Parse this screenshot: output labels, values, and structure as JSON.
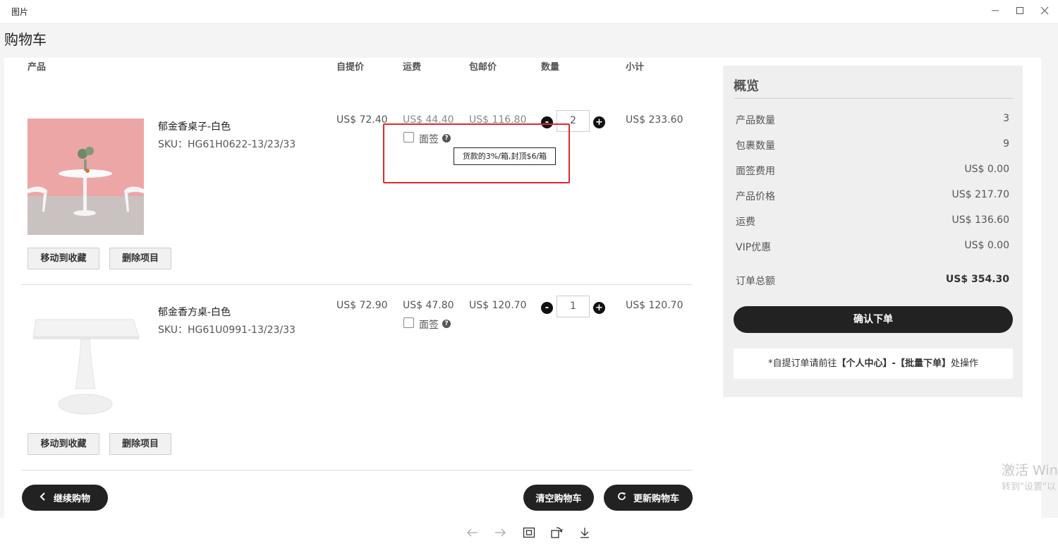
{
  "window": {
    "app_title": "图片"
  },
  "page": {
    "title": "购物车"
  },
  "table_headers": {
    "product": "产品",
    "pickup_price": "自提价",
    "shipping": "运费",
    "free_ship_price": "包邮价",
    "quantity": "数量",
    "subtotal": "小计"
  },
  "items": [
    {
      "name": "郁金香桌子-白色",
      "sku": "SKU：HG61H0622-13/23/33",
      "pickup_price": "US$ 72.40",
      "shipping": "US$ 44.40",
      "free_ship_price": "US$ 116.80",
      "quantity": "2",
      "subtotal": "US$ 233.60",
      "signature_label": "面签",
      "move_to_fav": "移动到收藏",
      "delete": "删除项目"
    },
    {
      "name": "郁金香方桌-白色",
      "sku": "SKU：HG61U0991-13/23/33",
      "pickup_price": "US$ 72.90",
      "shipping": "US$ 47.80",
      "free_ship_price": "US$ 120.70",
      "quantity": "1",
      "subtotal": "US$ 120.70",
      "signature_label": "面签",
      "move_to_fav": "移动到收藏",
      "delete": "删除项目"
    }
  ],
  "tooltip": "货款的3%/箱,封顶$6/箱",
  "qty_controls": {
    "minus": "-",
    "plus": "+"
  },
  "actions": {
    "continue_shopping": "继续购物",
    "clear_cart": "清空购物车",
    "update_cart": "更新购物车"
  },
  "summary": {
    "title": "概览",
    "rows": [
      {
        "label": "产品数量",
        "value": "3"
      },
      {
        "label": "包裹数量",
        "value": "9"
      },
      {
        "label": "面签费用",
        "value": "US$ 0.00"
      },
      {
        "label": "产品价格",
        "value": "US$ 217.70"
      },
      {
        "label": "运费",
        "value": "US$ 136.60"
      },
      {
        "label": "VIP优惠",
        "value": "US$ 0.00"
      }
    ],
    "total_label": "订单总额",
    "total_value": "US$ 354.30",
    "confirm": "确认下单",
    "note_prefix": "*自提订单请前往",
    "note_link1": "【个人中心】",
    "note_sep": "-",
    "note_link2": "【批量下单】",
    "note_suffix": "处操作"
  },
  "watermark": {
    "line1": "激活 Win",
    "line2": "转到\"设置\"以"
  },
  "icons": [
    "minimize-icon",
    "maximize-icon",
    "close-icon",
    "help-icon",
    "chevron-left-icon",
    "refresh-icon",
    "arrow-left-icon",
    "arrow-right-icon",
    "fit-screen-icon",
    "rotate-icon",
    "download-icon"
  ],
  "colors": {
    "dark_button": "#222222",
    "highlight_border": "#e0282b",
    "summary_bg": "#efefef"
  }
}
